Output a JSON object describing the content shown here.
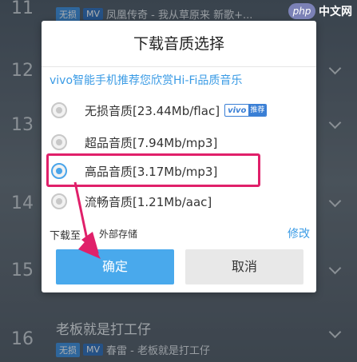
{
  "watermark": {
    "logo": "php",
    "text": "中文网"
  },
  "list": {
    "rows": [
      {
        "num": "11",
        "title": "",
        "tags": [
          "无损",
          "MV"
        ],
        "sub": "凤凰传奇 - 我从草原来 新歌+..."
      },
      {
        "num": "12",
        "title": "",
        "tags": [],
        "sub": ""
      },
      {
        "num": "13",
        "title": "",
        "tags": [],
        "sub": ""
      },
      {
        "num": "14",
        "title": "",
        "tags": [],
        "sub": ""
      },
      {
        "num": "15",
        "title": "",
        "tags": [],
        "sub": ""
      },
      {
        "num": "16",
        "title": "老板就是打工仔",
        "tags": [
          "无损",
          "MV"
        ],
        "sub": "春雷 - 老板就是打工仔"
      }
    ]
  },
  "dialog": {
    "title": "下载音质选择",
    "promo": "vivo智能手机推荐您欣赏Hi-Fi品质音乐",
    "options": [
      {
        "label": "无损音质[23.44Mb/flac]",
        "selected": false,
        "badge_brand": "vivo",
        "badge_tag": "推荐"
      },
      {
        "label": "超品音质[7.94Mb/mp3]",
        "selected": false
      },
      {
        "label": "高品音质[3.17Mb/mp3]",
        "selected": true
      },
      {
        "label": "流畅音质[1.21Mb/aac]",
        "selected": false
      }
    ],
    "download_to_label": "下载至",
    "download_to_value": "外部存储",
    "edit_label": "修改",
    "confirm_label": "确定",
    "cancel_label": "取消"
  },
  "colors": {
    "accent": "#49a9ec",
    "highlight": "#e0206a",
    "link": "#3a9be5"
  }
}
